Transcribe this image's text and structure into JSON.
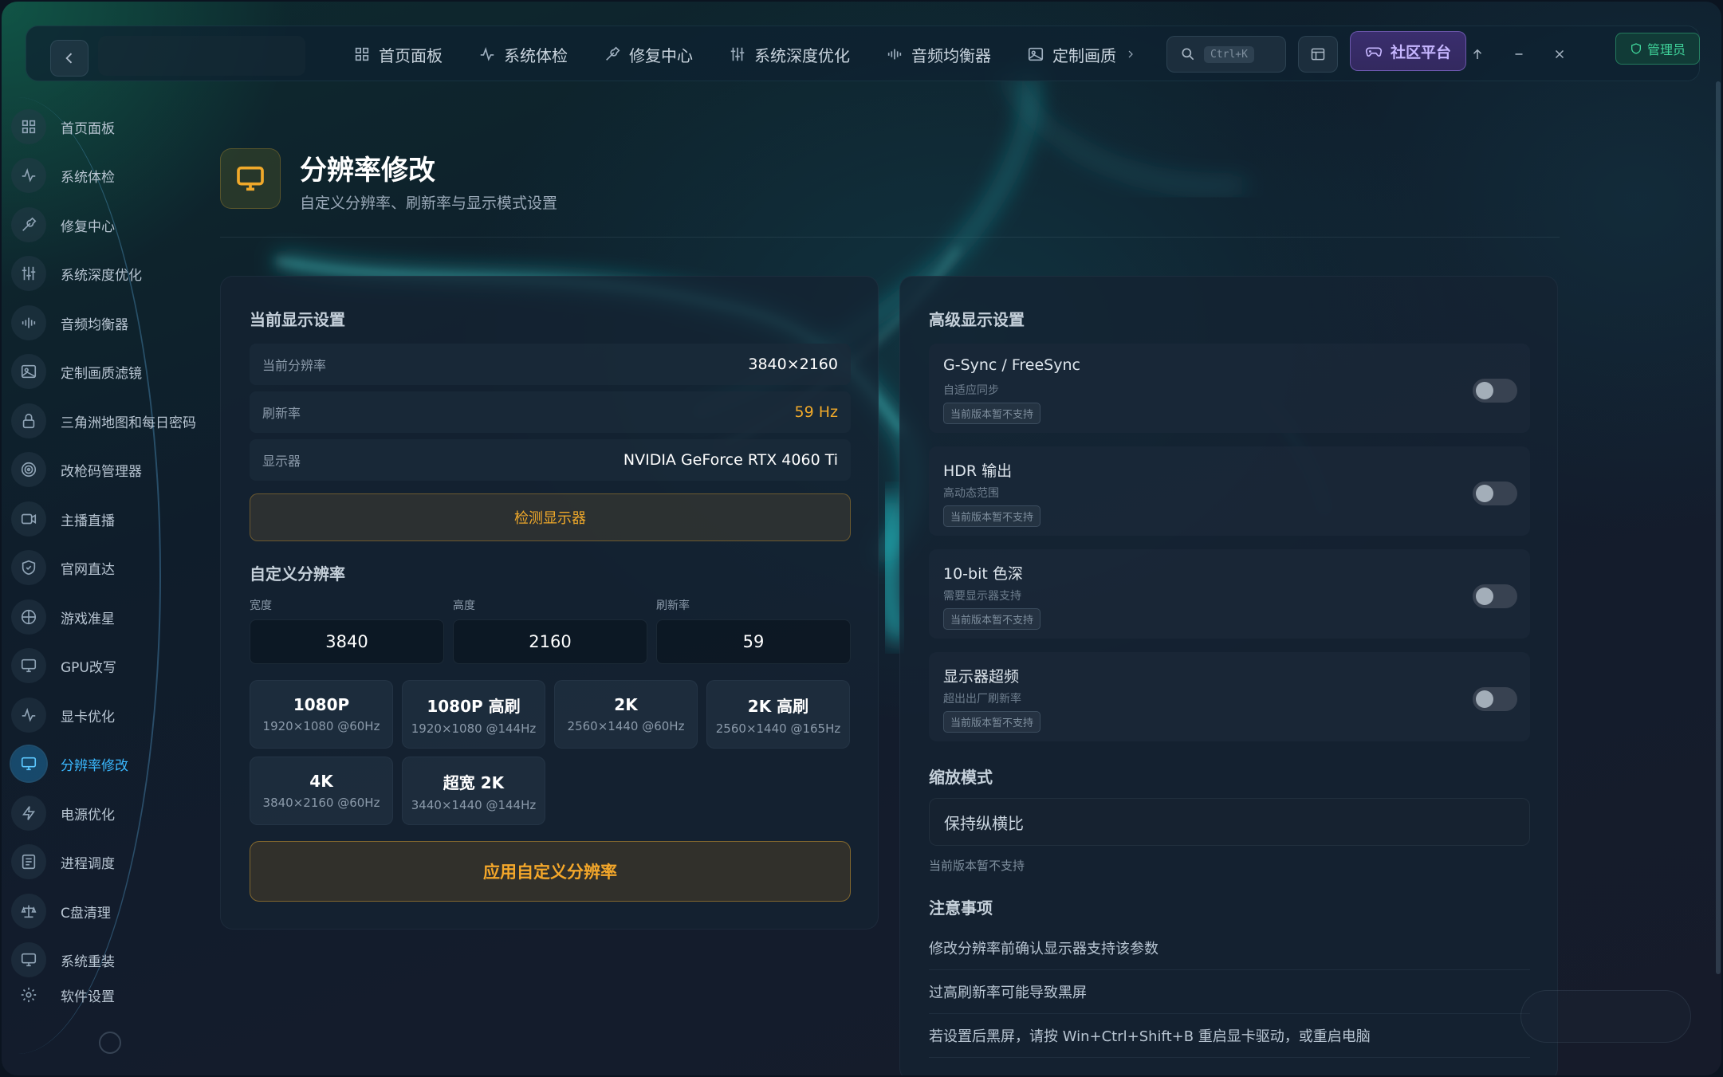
{
  "topbar": {
    "nav": [
      {
        "label": "首页面板",
        "icon": "grid-icon"
      },
      {
        "label": "系统体检",
        "icon": "pulse-icon"
      },
      {
        "label": "修复中心",
        "icon": "wrench-icon"
      },
      {
        "label": "系统深度优化",
        "icon": "sliders-icon"
      },
      {
        "label": "音频均衡器",
        "icon": "equalizer-icon"
      },
      {
        "label": "定制画质",
        "icon": "image-icon"
      }
    ],
    "search_shortcut": "Ctrl+K",
    "community_label": "社区平台",
    "admin_label": "管理员"
  },
  "sidebar": {
    "items": [
      {
        "label": "首页面板",
        "icon": "grid-icon"
      },
      {
        "label": "系统体检",
        "icon": "pulse-icon"
      },
      {
        "label": "修复中心",
        "icon": "wrench-icon"
      },
      {
        "label": "系统深度优化",
        "icon": "sliders-icon"
      },
      {
        "label": "音频均衡器",
        "icon": "equalizer-icon"
      },
      {
        "label": "定制画质滤镜",
        "icon": "image-icon"
      },
      {
        "label": "三角洲地图和每日密码",
        "icon": "lock-icon"
      },
      {
        "label": "改枪码管理器",
        "icon": "target-icon"
      },
      {
        "label": "主播直播",
        "icon": "video-icon"
      },
      {
        "label": "官网直达",
        "icon": "shield-icon"
      },
      {
        "label": "游戏准星",
        "icon": "crosshair-icon"
      },
      {
        "label": "GPU改写",
        "icon": "monitor-icon"
      },
      {
        "label": "显卡优化",
        "icon": "pulse-icon"
      },
      {
        "label": "分辨率修改",
        "icon": "monitor-icon",
        "active": true
      },
      {
        "label": "电源优化",
        "icon": "bolt-icon"
      },
      {
        "label": "进程调度",
        "icon": "list-icon"
      },
      {
        "label": "C盘清理",
        "icon": "scale-icon"
      },
      {
        "label": "系统重装",
        "icon": "monitor-icon"
      },
      {
        "label": "软件设置",
        "icon": "gear-icon"
      }
    ]
  },
  "page": {
    "title": "分辨率修改",
    "subtitle": "自定义分辨率、刷新率与显示模式设置"
  },
  "current": {
    "section_title": "当前显示设置",
    "rows": [
      {
        "label": "当前分辨率",
        "value": "3840×2160"
      },
      {
        "label": "刷新率",
        "value": "59 Hz"
      },
      {
        "label": "显示器",
        "value": "NVIDIA GeForce RTX 4060 Ti"
      }
    ],
    "detect_label": "检测显示器"
  },
  "custom": {
    "section_title": "自定义分辨率",
    "width_label": "宽度",
    "height_label": "高度",
    "refresh_label": "刷新率",
    "width_value": "3840",
    "height_value": "2160",
    "refresh_value": "59",
    "presets": [
      {
        "name": "1080P",
        "spec": "1920×1080 @60Hz"
      },
      {
        "name": "1080P 高刷",
        "spec": "1920×1080 @144Hz"
      },
      {
        "name": "2K",
        "spec": "2560×1440 @60Hz"
      },
      {
        "name": "2K 高刷",
        "spec": "2560×1440 @165Hz"
      },
      {
        "name": "4K",
        "spec": "3840×2160 @60Hz"
      },
      {
        "name": "超宽 2K",
        "spec": "3440×1440 @144Hz"
      }
    ],
    "apply_label": "应用自定义分辨率"
  },
  "advanced": {
    "section_title": "高级显示设置",
    "items": [
      {
        "title": "G-Sync / FreeSync",
        "desc": "自适应同步",
        "tag": "当前版本暂不支持",
        "enabled": false
      },
      {
        "title": "HDR 输出",
        "desc": "高动态范围",
        "tag": "当前版本暂不支持",
        "enabled": false
      },
      {
        "title": "10-bit 色深",
        "desc": "需要显示器支持",
        "tag": "当前版本暂不支持",
        "enabled": false
      },
      {
        "title": "显示器超频",
        "desc": "超出出厂刷新率",
        "tag": "当前版本暂不支持",
        "enabled": false
      }
    ],
    "scale_title": "缩放模式",
    "scale_value": "保持纵横比",
    "scale_note": "当前版本暂不支持",
    "notes_title": "注意事项",
    "notes": [
      "修改分辨率前确认显示器支持该参数",
      "过高刷新率可能导致黑屏",
      "若设置后黑屏，请按 Win+Ctrl+Shift+B 重启显卡驱动，或重启电脑"
    ]
  },
  "colors": {
    "accent_orange": "#f0a92a",
    "accent_blue": "#3ab8ff",
    "community_purple": "#c6b6ff",
    "admin_green": "#3fd39a"
  }
}
